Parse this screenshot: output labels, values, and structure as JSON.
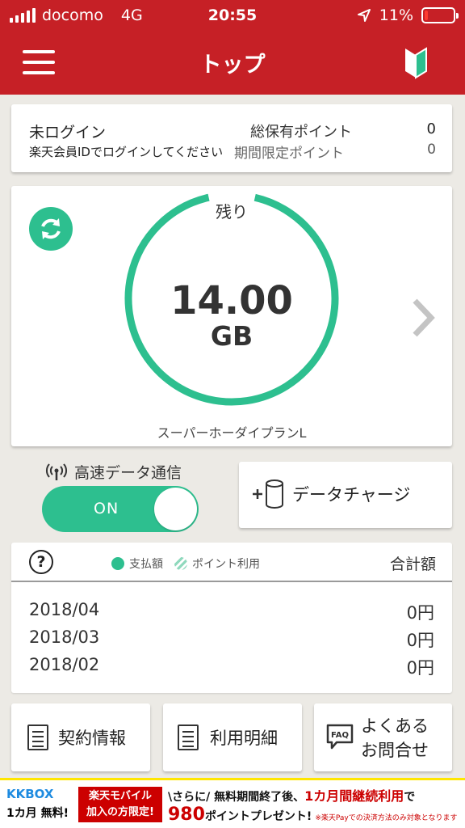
{
  "status_bar": {
    "carrier": "docomo",
    "network": "4G",
    "time": "20:55",
    "battery": "11%",
    "battery_level": 0.11
  },
  "nav": {
    "title": "トップ"
  },
  "account": {
    "login_status": "未ログイン",
    "login_prompt": "楽天会員IDでログインしてください",
    "total_points_label": "総保有ポイント",
    "total_points_value": "0",
    "limited_points_label": "期間限定ポイント",
    "limited_points_value": "0"
  },
  "usage": {
    "remaining_label": "残り",
    "value": "14.00",
    "unit": "GB",
    "plan": "スーパーホーダイプランL",
    "remaining_fraction": 1.0
  },
  "high_speed": {
    "label": "高速データ通信",
    "toggle_state": "ON"
  },
  "data_charge": {
    "label": "データチャージ"
  },
  "billing": {
    "legend_paid": "支払額",
    "legend_points": "ポイント利用",
    "total_label": "合計額",
    "rows": [
      {
        "month": "2018/04",
        "amount": "0円"
      },
      {
        "month": "2018/03",
        "amount": "0円"
      },
      {
        "month": "2018/02",
        "amount": "0円"
      }
    ]
  },
  "buttons": {
    "contract": "契約情報",
    "statement": "利用明細",
    "faq_line1": "よくある",
    "faq_line2": "お問合せ",
    "faq_badge": "FAQ"
  },
  "banner": {
    "kkbox": "KKBOX",
    "kkbox_sub": "1カ月 無料!",
    "rakuten_line1": "楽天モバイル",
    "rakuten_line2": "加入の方限定!",
    "promo_prefix": "\\さらに/ 無料期間終了後、",
    "promo_highlight": "1カ月間継続利用",
    "promo_suffix": "で",
    "promo_points": "980",
    "promo_points_suffix": "ポイントプレゼント!",
    "promo_note": "※楽天Payでの決済方法のみ対象となります"
  },
  "colors": {
    "brand_red": "#c62026",
    "accent_green": "#2dbf8f",
    "background": "#eceae5"
  }
}
